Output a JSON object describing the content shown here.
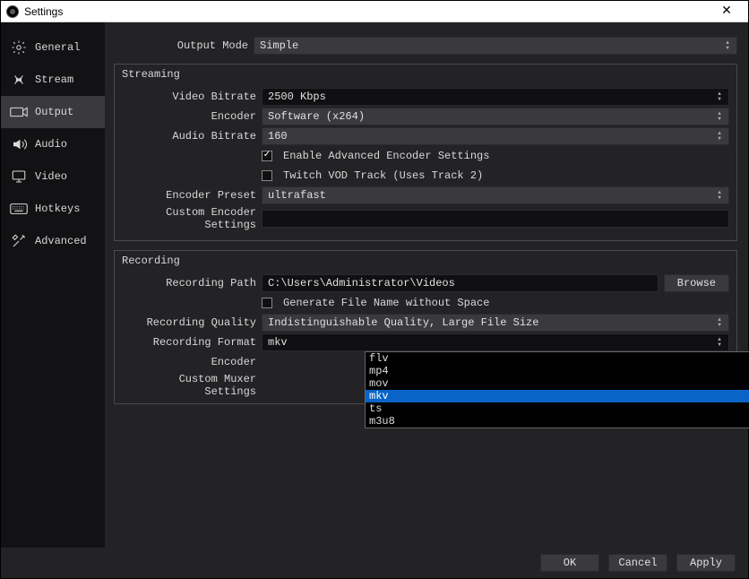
{
  "window": {
    "title": "Settings"
  },
  "sidebar": {
    "general": "General",
    "stream": "Stream",
    "output": "Output",
    "audio": "Audio",
    "video": "Video",
    "hotkeys": "Hotkeys",
    "advanced": "Advanced"
  },
  "top": {
    "output_mode_label": "Output Mode",
    "output_mode_value": "Simple"
  },
  "streaming": {
    "section_title": "Streaming",
    "video_bitrate_label": "Video Bitrate",
    "video_bitrate_value": "2500 Kbps",
    "encoder_label": "Encoder",
    "encoder_value": "Software (x264)",
    "audio_bitrate_label": "Audio Bitrate",
    "audio_bitrate_value": "160",
    "enable_adv_label": "Enable Advanced Encoder Settings",
    "twitch_vod_label": "Twitch VOD Track (Uses Track 2)",
    "encoder_preset_label": "Encoder Preset",
    "encoder_preset_value": "ultrafast",
    "custom_enc_label": "Custom Encoder Settings",
    "custom_enc_value": ""
  },
  "recording": {
    "section_title": "Recording",
    "path_label": "Recording Path",
    "path_value": "C:\\Users\\Administrator\\Videos",
    "browse_label": "Browse",
    "gen_name_label": "Generate File Name without Space",
    "quality_label": "Recording Quality",
    "quality_value": "Indistinguishable Quality, Large File Size",
    "format_label": "Recording Format",
    "format_value": "mkv",
    "format_options": [
      "flv",
      "mp4",
      "mov",
      "mkv",
      "ts",
      "m3u8"
    ],
    "encoder_label": "Encoder",
    "encoder_value": "",
    "custom_muxer_label": "Custom Muxer Settings",
    "custom_muxer_value": ""
  },
  "footer": {
    "ok": "OK",
    "cancel": "Cancel",
    "apply": "Apply"
  }
}
